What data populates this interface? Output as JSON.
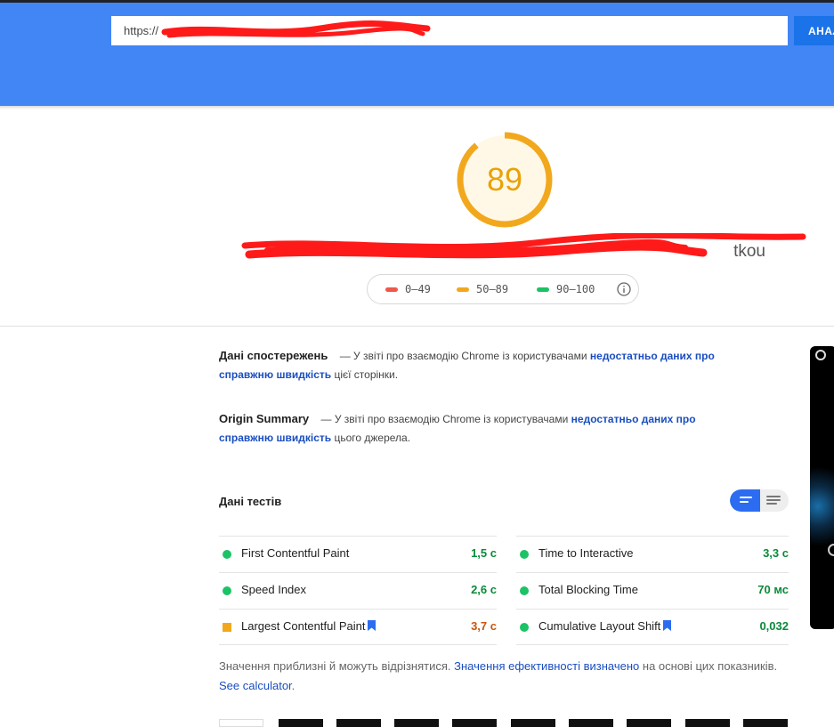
{
  "header": {
    "url_value": "https://",
    "analyze_label": "АНАЛ"
  },
  "score": {
    "value": "89",
    "fraction": 0.89,
    "color": "#e8a208",
    "site_url_visible": "tkou"
  },
  "legend": [
    {
      "range": "0–49",
      "color": "#f0574b"
    },
    {
      "range": "50–89",
      "color": "#f2a81d"
    },
    {
      "range": "90–100",
      "color": "#1cc266"
    }
  ],
  "field_data": {
    "title": "Дані спостережень",
    "text_before": "— У звіті про взаємодію Chrome із користувачами",
    "link": "недостатньо даних про справжню швидкість",
    "text_after": "цієї сторінки."
  },
  "origin_summary": {
    "title": "Origin Summary",
    "text_before": "— У звіті про взаємодію Chrome із користувачами",
    "link": "недостатньо даних про справжню швидкість",
    "text_after": "цього джерела."
  },
  "lab_data": {
    "title": "Дані тестів",
    "metrics_left": [
      {
        "name": "First Contentful Paint",
        "value": "1,5 с",
        "status": "good",
        "bookmark": false
      },
      {
        "name": "Speed Index",
        "value": "2,6 с",
        "status": "good",
        "bookmark": false
      },
      {
        "name": "Largest Contentful Paint",
        "value": "3,7 с",
        "status": "average",
        "bookmark": true
      }
    ],
    "metrics_right": [
      {
        "name": "Time to Interactive",
        "value": "3,3 с",
        "status": "good",
        "bookmark": false
      },
      {
        "name": "Total Blocking Time",
        "value": "70 мс",
        "status": "good",
        "bookmark": false
      },
      {
        "name": "Cumulative Layout Shift",
        "value": "0,032",
        "status": "good",
        "bookmark": true
      }
    ]
  },
  "note": {
    "text": "Значення приблизні й можуть відрізнятися.",
    "link1": "Значення ефективності визначено",
    "text2": "на основі цих показників.",
    "link2": "See calculator",
    "text3": "."
  },
  "colors": {
    "header_bg": "#4285f4",
    "good": "#1cc266",
    "average": "#f2a81d",
    "good_value": "#0a8a3a",
    "average_value": "#c8560c",
    "link": "#1a4ec0"
  }
}
